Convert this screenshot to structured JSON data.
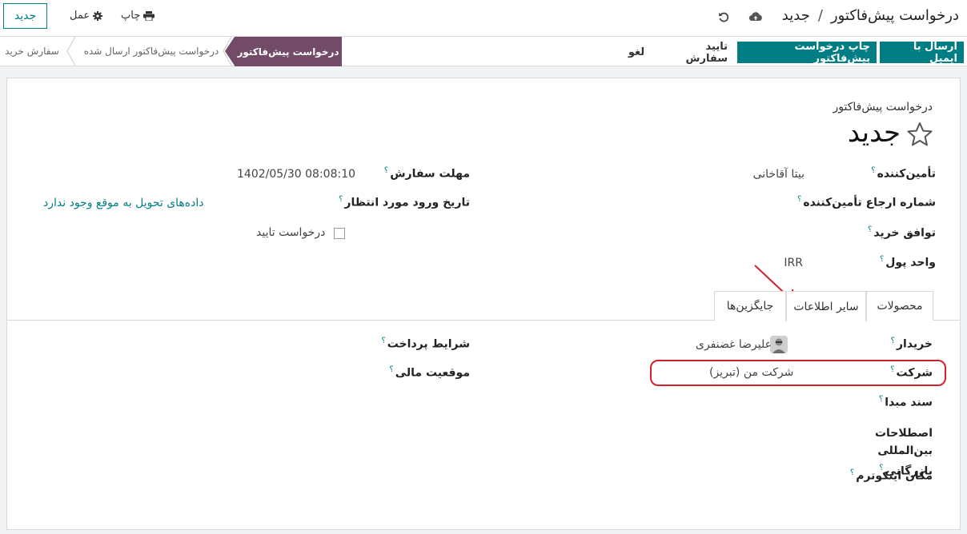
{
  "header": {
    "breadcrumb_parent": "درخواست پیش‌فاکتور",
    "breadcrumb_separator": "/",
    "breadcrumb_current": "جدید",
    "new_button": "جدید",
    "action_label": "عمل",
    "print_label": "چاپ"
  },
  "statusbar": {
    "actions": [
      "ارسال با ایمیل",
      "چاپ درخواست پیش‌فاکتور",
      "تایید سفارش",
      "لغو"
    ],
    "stages": [
      "درخواست پیش‌فاکتور",
      "درخواست پیش‌فاکتور ارسال شده",
      "سفارش خرید"
    ],
    "active_stage": "درخواست پیش‌فاکتور",
    "active_color": "#714b67",
    "primary_color": "#017e84"
  },
  "form": {
    "subtitle": "درخواست پیش‌فاکتور",
    "title": "جدید",
    "help_mark": "؟",
    "fields_right": [
      {
        "label": "تأمین‌کننده",
        "value": "بیتا آقاخانی"
      },
      {
        "label": "شماره ارجاع تأمین‌کننده",
        "value": ""
      },
      {
        "label": "توافق خرید",
        "value": ""
      },
      {
        "label": "واحد پول",
        "value": "IRR"
      }
    ],
    "fields_left": [
      {
        "label": "مهلت سفارش",
        "value": "1402/05/30 08:08:10"
      },
      {
        "label": "تاریخ ورود مورد انتظار",
        "value": "داده‌های تحویل به موقع وجود ندارد"
      }
    ],
    "approval_checkbox_label": "درخواست تایید"
  },
  "tabs": [
    "محصولات",
    "سایر اطلاعات",
    "جایگزین‌ها"
  ],
  "active_tab": "سایر اطلاعات",
  "other_info": {
    "fields_right": [
      {
        "label": "خریدار",
        "value": "علیرضا غضنفری"
      },
      {
        "label": "شرکت",
        "value": "شرکت من (تبریز)"
      },
      {
        "label": "سند مبدا",
        "value": ""
      },
      {
        "label": "اصطلاحات بین‌المللی بازرگانی",
        "value": ""
      },
      {
        "label": "مکان اینکوترم",
        "value": ""
      }
    ],
    "fields_left": [
      {
        "label": "شرایط پرداخت",
        "value": ""
      },
      {
        "label": "موقعیت مالی",
        "value": ""
      }
    ],
    "incoterm_label_line1": "اصطلاحات بین‌المللی",
    "incoterm_label_line2": "بازرگانی"
  },
  "annotation_color": "#d6202e"
}
